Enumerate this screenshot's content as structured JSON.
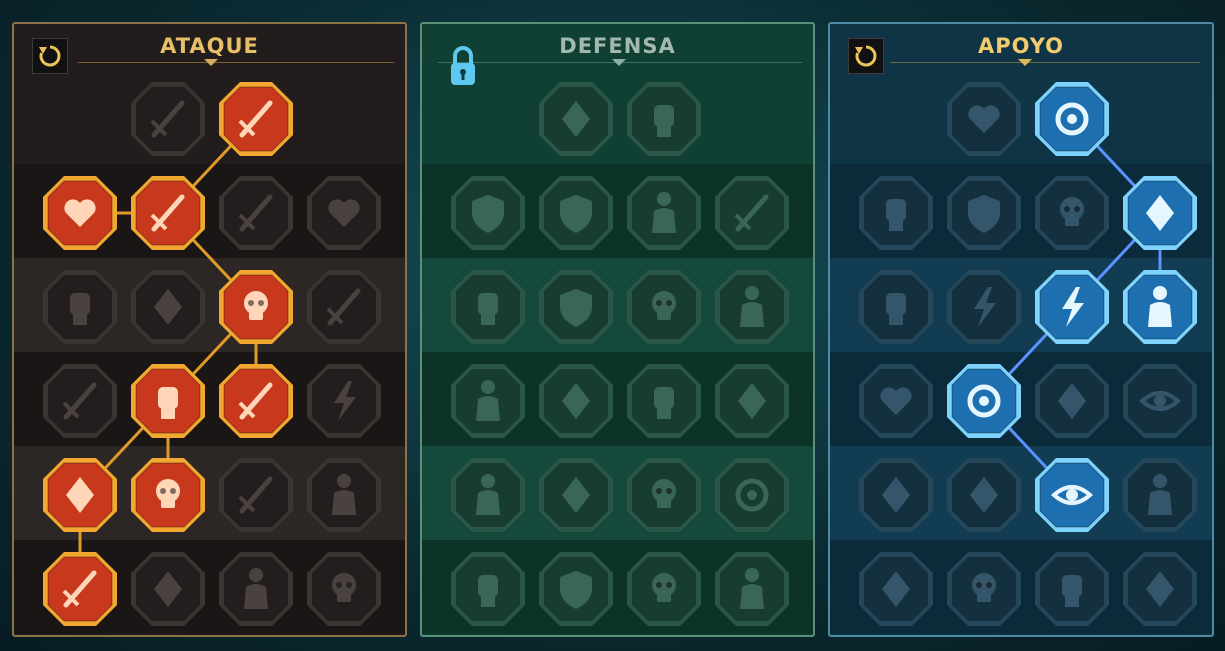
{
  "panels": [
    {
      "id": "ataque",
      "title": "ATAQUE",
      "control": "reset",
      "theme": "red",
      "nodes": [
        {
          "row": 0,
          "col": 1,
          "icon": "crossed-swords-icon",
          "active": false
        },
        {
          "row": 0,
          "col": 2,
          "icon": "dagger-slash-icon",
          "active": true
        },
        {
          "row": 1,
          "col": 0,
          "icon": "horned-demon-heart-icon",
          "active": true
        },
        {
          "row": 1,
          "col": 1,
          "icon": "sword-claw-slash-icon",
          "active": true
        },
        {
          "row": 1,
          "col": 2,
          "icon": "shield-sword-icon",
          "active": false
        },
        {
          "row": 1,
          "col": 3,
          "icon": "bleeding-heart-icon",
          "active": false
        },
        {
          "row": 2,
          "col": 0,
          "icon": "fist-strike-icon",
          "active": false
        },
        {
          "row": 2,
          "col": 1,
          "icon": "fanged-maw-icon",
          "active": false
        },
        {
          "row": 2,
          "col": 2,
          "icon": "skull-slash-icon",
          "active": true
        },
        {
          "row": 2,
          "col": 3,
          "icon": "scythe-hand-icon",
          "active": false
        },
        {
          "row": 3,
          "col": 0,
          "icon": "sword-shield-icon",
          "active": false
        },
        {
          "row": 3,
          "col": 1,
          "icon": "fist-hammer-icon",
          "active": true
        },
        {
          "row": 3,
          "col": 2,
          "icon": "axe-up-icon",
          "active": true
        },
        {
          "row": 3,
          "col": 3,
          "icon": "chain-lightning-icon",
          "active": false
        },
        {
          "row": 4,
          "col": 0,
          "icon": "arrows-burst-icon",
          "active": true
        },
        {
          "row": 4,
          "col": 1,
          "icon": "triple-skull-icon",
          "active": true
        },
        {
          "row": 4,
          "col": 2,
          "icon": "broken-sword-icon",
          "active": false
        },
        {
          "row": 4,
          "col": 3,
          "icon": "warrior-flex-icon",
          "active": false
        },
        {
          "row": 5,
          "col": 0,
          "icon": "sword-sparkle-icon",
          "active": true
        },
        {
          "row": 5,
          "col": 1,
          "icon": "knight-helm-icon",
          "active": false
        },
        {
          "row": 5,
          "col": 2,
          "icon": "horned-beast-icon",
          "active": false
        },
        {
          "row": 5,
          "col": 3,
          "icon": "spartan-skull-icon",
          "active": false
        }
      ],
      "links": [
        [
          [
            0,
            2
          ],
          [
            1,
            1
          ]
        ],
        [
          [
            1,
            0
          ],
          [
            1,
            1
          ]
        ],
        [
          [
            1,
            1
          ],
          [
            2,
            2
          ]
        ],
        [
          [
            2,
            2
          ],
          [
            3,
            2
          ]
        ],
        [
          [
            2,
            2
          ],
          [
            3,
            1
          ]
        ],
        [
          [
            3,
            1
          ],
          [
            4,
            0
          ]
        ],
        [
          [
            3,
            1
          ],
          [
            4,
            1
          ]
        ],
        [
          [
            4,
            0
          ],
          [
            5,
            0
          ]
        ]
      ]
    },
    {
      "id": "defensa",
      "title": "DEFENSA",
      "control": "lock",
      "theme": "green",
      "nodes": [
        {
          "row": 0,
          "col": 1,
          "icon": "brick-wall-icon",
          "active": false
        },
        {
          "row": 0,
          "col": 2,
          "icon": "raised-fist-icon",
          "active": false
        },
        {
          "row": 1,
          "col": 0,
          "icon": "armor-shield-icon",
          "active": false
        },
        {
          "row": 1,
          "col": 1,
          "icon": "flame-shield-icon",
          "active": false
        },
        {
          "row": 1,
          "col": 2,
          "icon": "meditating-figure-icon",
          "active": false
        },
        {
          "row": 1,
          "col": 3,
          "icon": "deflect-slash-icon",
          "active": false
        },
        {
          "row": 2,
          "col": 0,
          "icon": "tough-arm-icon",
          "active": false
        },
        {
          "row": 2,
          "col": 1,
          "icon": "shield-block-icon",
          "active": false
        },
        {
          "row": 2,
          "col": 2,
          "icon": "heart-skull-icon",
          "active": false
        },
        {
          "row": 2,
          "col": 3,
          "icon": "sun-figure-icon",
          "active": false
        },
        {
          "row": 3,
          "col": 0,
          "icon": "twin-warriors-icon",
          "active": false
        },
        {
          "row": 3,
          "col": 1,
          "icon": "hourglass-burst-icon",
          "active": false
        },
        {
          "row": 3,
          "col": 2,
          "icon": "open-hand-icon",
          "active": false
        },
        {
          "row": 3,
          "col": 3,
          "icon": "bull-head-icon",
          "active": false
        },
        {
          "row": 4,
          "col": 0,
          "icon": "runner-speed-icon",
          "active": false
        },
        {
          "row": 4,
          "col": 1,
          "icon": "water-drops-icon",
          "active": false
        },
        {
          "row": 4,
          "col": 2,
          "icon": "skull-circle-icon",
          "active": false
        },
        {
          "row": 4,
          "col": 3,
          "icon": "swirl-strike-icon",
          "active": false
        },
        {
          "row": 5,
          "col": 0,
          "icon": "armored-torso-icon",
          "active": false
        },
        {
          "row": 5,
          "col": 1,
          "icon": "crossed-shield-icon",
          "active": false
        },
        {
          "row": 5,
          "col": 2,
          "icon": "skull-pile-icon",
          "active": false
        },
        {
          "row": 5,
          "col": 3,
          "icon": "champion-figure-icon",
          "active": false
        }
      ],
      "links": []
    },
    {
      "id": "apoyo",
      "title": "APOYO",
      "control": "reset",
      "theme": "blue",
      "nodes": [
        {
          "row": 0,
          "col": 1,
          "icon": "heart-sparkle-icon",
          "active": false
        },
        {
          "row": 0,
          "col": 2,
          "icon": "spiral-strike-icon",
          "active": true
        },
        {
          "row": 1,
          "col": 0,
          "icon": "praying-hands-icon",
          "active": false
        },
        {
          "row": 1,
          "col": 1,
          "icon": "shield-rings-icon",
          "active": false
        },
        {
          "row": 1,
          "col": 2,
          "icon": "smoke-skull-icon",
          "active": false
        },
        {
          "row": 1,
          "col": 3,
          "icon": "ice-slam-icon",
          "active": true
        },
        {
          "row": 2,
          "col": 0,
          "icon": "arms-raised-icon",
          "active": false
        },
        {
          "row": 2,
          "col": 1,
          "icon": "lightning-bolt-icon",
          "active": false
        },
        {
          "row": 2,
          "col": 2,
          "icon": "shatter-icon",
          "active": true
        },
        {
          "row": 2,
          "col": 3,
          "icon": "group-silhouettes-icon",
          "active": true
        },
        {
          "row": 3,
          "col": 0,
          "icon": "chained-heart-icon",
          "active": false
        },
        {
          "row": 3,
          "col": 1,
          "icon": "comet-icon",
          "active": true
        },
        {
          "row": 3,
          "col": 2,
          "icon": "open-book-icon",
          "active": false
        },
        {
          "row": 3,
          "col": 3,
          "icon": "demon-eyes-icon",
          "active": false
        },
        {
          "row": 4,
          "col": 0,
          "icon": "compass-star-icon",
          "active": false
        },
        {
          "row": 4,
          "col": 1,
          "icon": "swift-boot-icon",
          "active": false
        },
        {
          "row": 4,
          "col": 2,
          "icon": "all-seeing-eye-icon",
          "active": true
        },
        {
          "row": 4,
          "col": 3,
          "icon": "broken-figure-icon",
          "active": false
        },
        {
          "row": 5,
          "col": 0,
          "icon": "poison-flask-icon",
          "active": false
        },
        {
          "row": 5,
          "col": 1,
          "icon": "skull-icon",
          "active": false
        },
        {
          "row": 5,
          "col": 2,
          "icon": "crushing-fist-icon",
          "active": false
        },
        {
          "row": 5,
          "col": 3,
          "icon": "eagle-head-icon",
          "active": false
        }
      ],
      "links": [
        [
          [
            0,
            2
          ],
          [
            1,
            3
          ]
        ],
        [
          [
            1,
            3
          ],
          [
            2,
            2
          ]
        ],
        [
          [
            1,
            3
          ],
          [
            2,
            3
          ]
        ],
        [
          [
            2,
            2
          ],
          [
            3,
            1
          ]
        ],
        [
          [
            3,
            1
          ],
          [
            4,
            2
          ]
        ]
      ]
    }
  ],
  "themes": {
    "red": {
      "accent": "#f2a830",
      "fill": "#c8381c",
      "glyph": "#ffd6b8",
      "link": "#e09a2a"
    },
    "green": {
      "accent": "#5c8a78",
      "fill": "#1a3f34",
      "glyph": "#3f6a5a",
      "link": "#5c8a78"
    },
    "blue": {
      "accent": "#7fd4ff",
      "fill": "#1d6fb0",
      "glyph": "#e6f6ff",
      "link": "#5a93ff"
    }
  }
}
